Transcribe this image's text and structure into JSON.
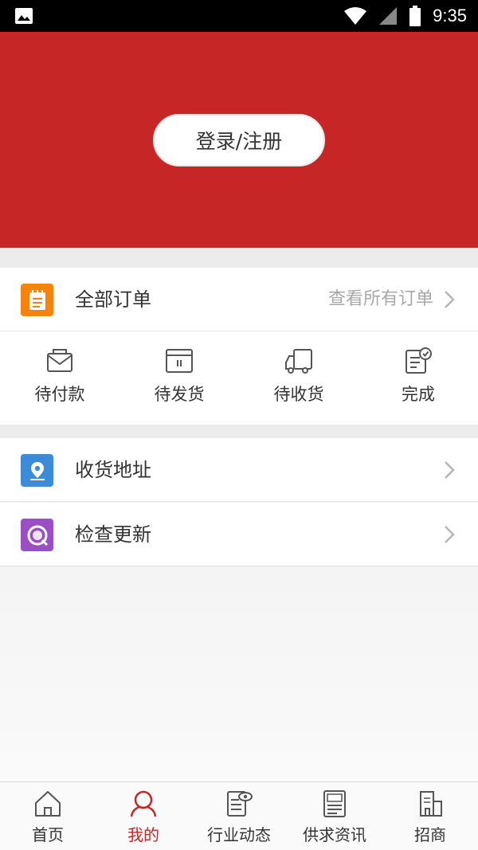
{
  "status_bar": {
    "time": "9:35",
    "icons": [
      "image-icon",
      "wifi-icon",
      "signal-icon",
      "battery-icon"
    ]
  },
  "header": {
    "background": "#c62626",
    "login_label": "登录/注册"
  },
  "orders": {
    "title": "全部订单",
    "view_all": "查看所有订单",
    "icon": "order-list-icon",
    "icon_color": "#f7830c",
    "statuses": [
      {
        "label": "待付款",
        "icon": "pending-payment-icon"
      },
      {
        "label": "待发货",
        "icon": "pending-shipment-icon"
      },
      {
        "label": "待收货",
        "icon": "pending-receipt-icon"
      },
      {
        "label": "完成",
        "icon": "completed-icon"
      }
    ]
  },
  "menu": [
    {
      "label": "收货地址",
      "icon": "location-icon",
      "icon_color": "#3b8bd8"
    },
    {
      "label": "检查更新",
      "icon": "update-icon",
      "icon_color": "#9a4fc4"
    }
  ],
  "tabs": [
    {
      "label": "首页",
      "icon": "home-icon",
      "active": false
    },
    {
      "label": "我的",
      "icon": "profile-icon",
      "active": true
    },
    {
      "label": "行业动态",
      "icon": "news-icon",
      "active": false
    },
    {
      "label": "供求资讯",
      "icon": "supply-demand-icon",
      "active": false
    },
    {
      "label": "招商",
      "icon": "business-icon",
      "active": false
    }
  ],
  "colors": {
    "accent": "#c62626",
    "icon_gray": "#555555"
  }
}
